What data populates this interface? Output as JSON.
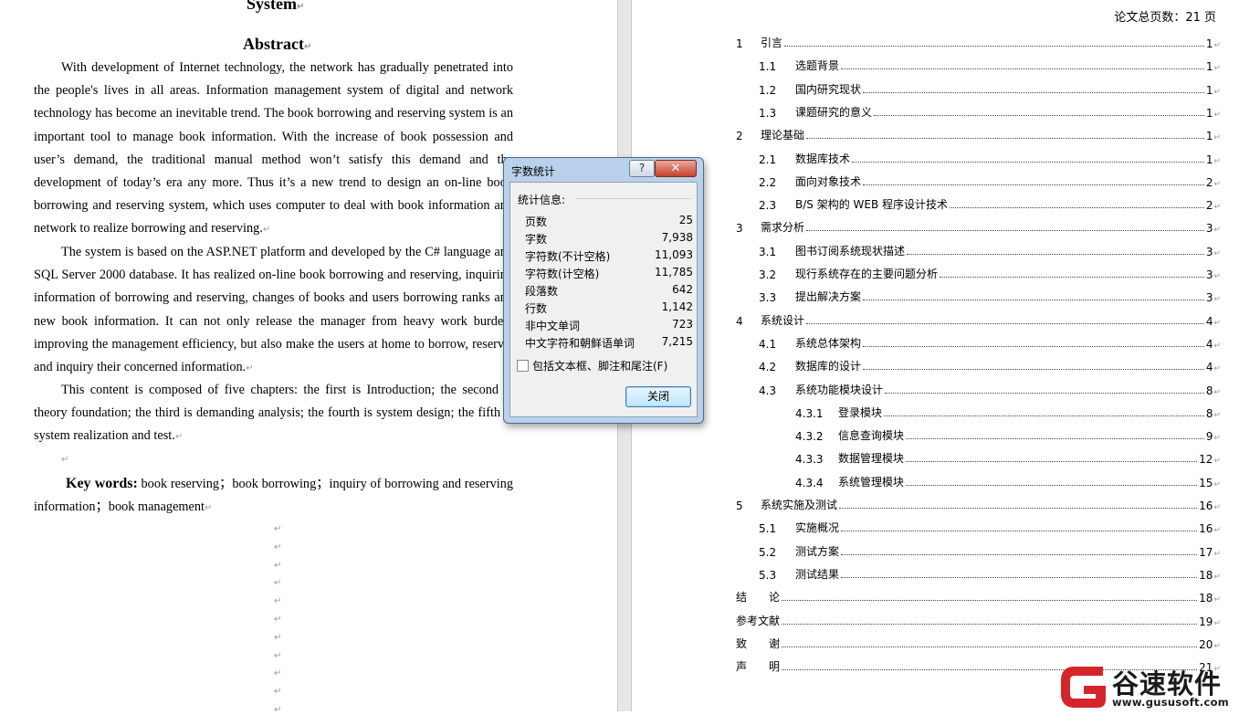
{
  "left_page": {
    "title_tail": "System",
    "abstract_heading": "Abstract",
    "paragraphs": [
      "With development of Internet technology, the network has gradually penetrated into the people's lives in all areas. Information management system of digital and network technology has become an inevitable trend. The book borrowing and reserving system is an important tool to manage book information. With the increase of book possession and user’s demand, the traditional manual method won’t satisfy this demand and the development of today’s era any more. Thus it’s a new trend to design an on-line book borrowing and reserving system, which uses computer to deal with book information and network to realize borrowing and reserving.",
      "The system is based on the ASP.NET platform and developed by the C# language and SQL Server 2000 database. It has realized on-line book borrowing and reserving, inquiring information of borrowing and reserving, changes of books and users borrowing ranks and new book information. It can not only release the manager from heavy work burden, improving the management efficiency, but also make the users at home to borrow, reserve, and inquiry their concerned information.",
      "This content is composed of five chapters: the first is Introduction; the second is theory foundation; the third is demanding analysis; the fourth is system design; the fifth is system realization and test."
    ],
    "keywords_label": "Key words:",
    "keywords_text": " book reserving；book borrowing；inquiry of borrowing and reserving information；book management",
    "paragraph_mark": "↵"
  },
  "dialog": {
    "title": "字数统计",
    "help": "?",
    "close_x": "✕",
    "caption": "统计信息:",
    "stats": [
      {
        "label": "页数",
        "value": "25"
      },
      {
        "label": "字数",
        "value": "7,938"
      },
      {
        "label": "字符数(不计空格)",
        "value": "11,093"
      },
      {
        "label": "字符数(计空格)",
        "value": "11,785"
      },
      {
        "label": "段落数",
        "value": "642"
      },
      {
        "label": "行数",
        "value": "1,142"
      },
      {
        "label": "非中文单词",
        "value": "723"
      },
      {
        "label": "中文字符和朝鲜语单词",
        "value": "7,215"
      }
    ],
    "checkbox_label": "包括文本框、脚注和尾注(F)",
    "checkbox_checked": false,
    "close_button": "关闭"
  },
  "toc": {
    "total_pages": "论文总页数：21 页",
    "entries": [
      {
        "num": "1",
        "title": "引言",
        "page": "1",
        "level": 1
      },
      {
        "num": "1.1",
        "title": "选题背景",
        "page": "1",
        "level": 2
      },
      {
        "num": "1.2",
        "title": "国内研究现状",
        "page": "1",
        "level": 2
      },
      {
        "num": "1.3",
        "title": "课题研究的意义",
        "page": "1",
        "level": 2
      },
      {
        "num": "2",
        "title": "理论基础",
        "page": "1",
        "level": 1
      },
      {
        "num": "2.1",
        "title": "数据库技术",
        "page": "1",
        "level": 2
      },
      {
        "num": "2.2",
        "title": "面向对象技术",
        "page": "2",
        "level": 2
      },
      {
        "num": "2.3",
        "title": "B/S 架构的 WEB 程序设计技术",
        "page": "2",
        "level": 2
      },
      {
        "num": "3",
        "title": "需求分析",
        "page": "3",
        "level": 1
      },
      {
        "num": "3.1",
        "title": "图书订阅系统现状描述",
        "page": "3",
        "level": 2
      },
      {
        "num": "3.2",
        "title": "现行系统存在的主要问题分析",
        "page": "3",
        "level": 2
      },
      {
        "num": "3.3",
        "title": "提出解决方案",
        "page": "3",
        "level": 2
      },
      {
        "num": "4",
        "title": "系统设计",
        "page": "4",
        "level": 1
      },
      {
        "num": "4.1",
        "title": "系统总体架构",
        "page": "4",
        "level": 2
      },
      {
        "num": "4.2",
        "title": "数据库的设计",
        "page": "4",
        "level": 2
      },
      {
        "num": "4.3",
        "title": "系统功能模块设计",
        "page": "8",
        "level": 2
      },
      {
        "num": "4.3.1",
        "title": "登录模块",
        "page": "8",
        "level": 3
      },
      {
        "num": "4.3.2",
        "title": "信息查询模块",
        "page": "9",
        "level": 3
      },
      {
        "num": "4.3.3",
        "title": "数据管理模块",
        "page": "12",
        "level": 3
      },
      {
        "num": "4.3.4",
        "title": "系统管理模块",
        "page": "15",
        "level": 3
      },
      {
        "num": "5",
        "title": "系统实施及测试",
        "page": "16",
        "level": 1
      },
      {
        "num": "5.1",
        "title": "实施概况",
        "page": "16",
        "level": 2
      },
      {
        "num": "5.2",
        "title": "测试方案",
        "page": "17",
        "level": 2
      },
      {
        "num": "5.3",
        "title": "测试结果",
        "page": "18",
        "level": 2
      },
      {
        "num": "",
        "title": "结　　论",
        "page": "18",
        "level": 0
      },
      {
        "num": "",
        "title": "参考文献",
        "page": "19",
        "level": 0
      },
      {
        "num": "",
        "title": "致　　谢",
        "page": "20",
        "level": 0
      },
      {
        "num": "",
        "title": "声　　明",
        "page": "21",
        "level": 0
      }
    ]
  },
  "watermark": {
    "brand": "谷速软件",
    "url": "www.gususoft.com",
    "color": "#d4252a"
  }
}
